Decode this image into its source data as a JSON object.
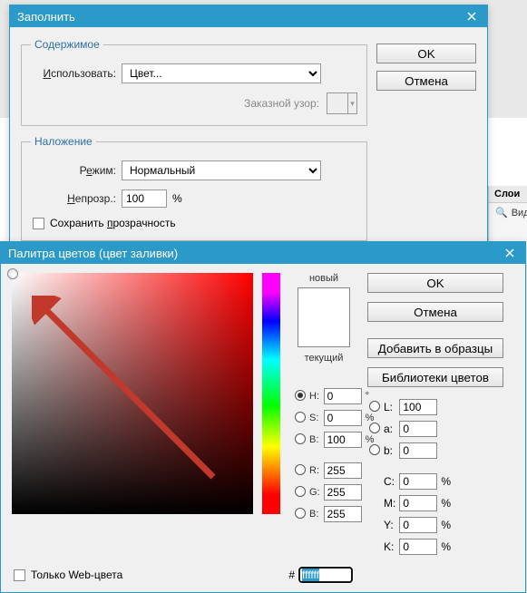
{
  "fill": {
    "title": "Заполнить",
    "content_legend": "Содержимое",
    "use_label": "Использовать:",
    "use_value": "Цвет...",
    "custom_pattern_label": "Заказной узор:",
    "overlay_legend": "Наложение",
    "mode_label": "Режим:",
    "mode_value": "Нормальный",
    "opacity_label": "Непрозр.:",
    "opacity_value": "100",
    "opacity_unit": "%",
    "preserve_label": "Сохранить прозрачность",
    "ok": "OK",
    "cancel": "Отмена"
  },
  "side": {
    "tab": "Слои",
    "row1": "Вид"
  },
  "picker": {
    "title": "Палитра цветов (цвет заливки)",
    "new_label": "новый",
    "current_label": "текущий",
    "ok": "OK",
    "cancel": "Отмена",
    "add_swatch": "Добавить в образцы",
    "color_libs": "Библиотеки цветов",
    "hsb": {
      "h_label": "H:",
      "h_value": "0",
      "h_unit": "°",
      "s_label": "S:",
      "s_value": "0",
      "s_unit": "%",
      "b_label": "B:",
      "b_value": "100",
      "b_unit": "%"
    },
    "rgb": {
      "r_label": "R:",
      "r_value": "255",
      "g_label": "G:",
      "g_value": "255",
      "b_label": "B:",
      "b_value": "255"
    },
    "lab": {
      "l_label": "L:",
      "l_value": "100",
      "a_label": "a:",
      "a_value": "0",
      "b_label": "b:",
      "b_value": "0"
    },
    "cmyk": {
      "c_label": "C:",
      "c_value": "0",
      "c_unit": "%",
      "m_label": "M:",
      "m_value": "0",
      "m_unit": "%",
      "y_label": "Y:",
      "y_value": "0",
      "y_unit": "%",
      "k_label": "K:",
      "k_value": "0",
      "k_unit": "%"
    },
    "web_only": "Только Web-цвета",
    "hex_label": "#",
    "hex_value": "ffffff"
  }
}
